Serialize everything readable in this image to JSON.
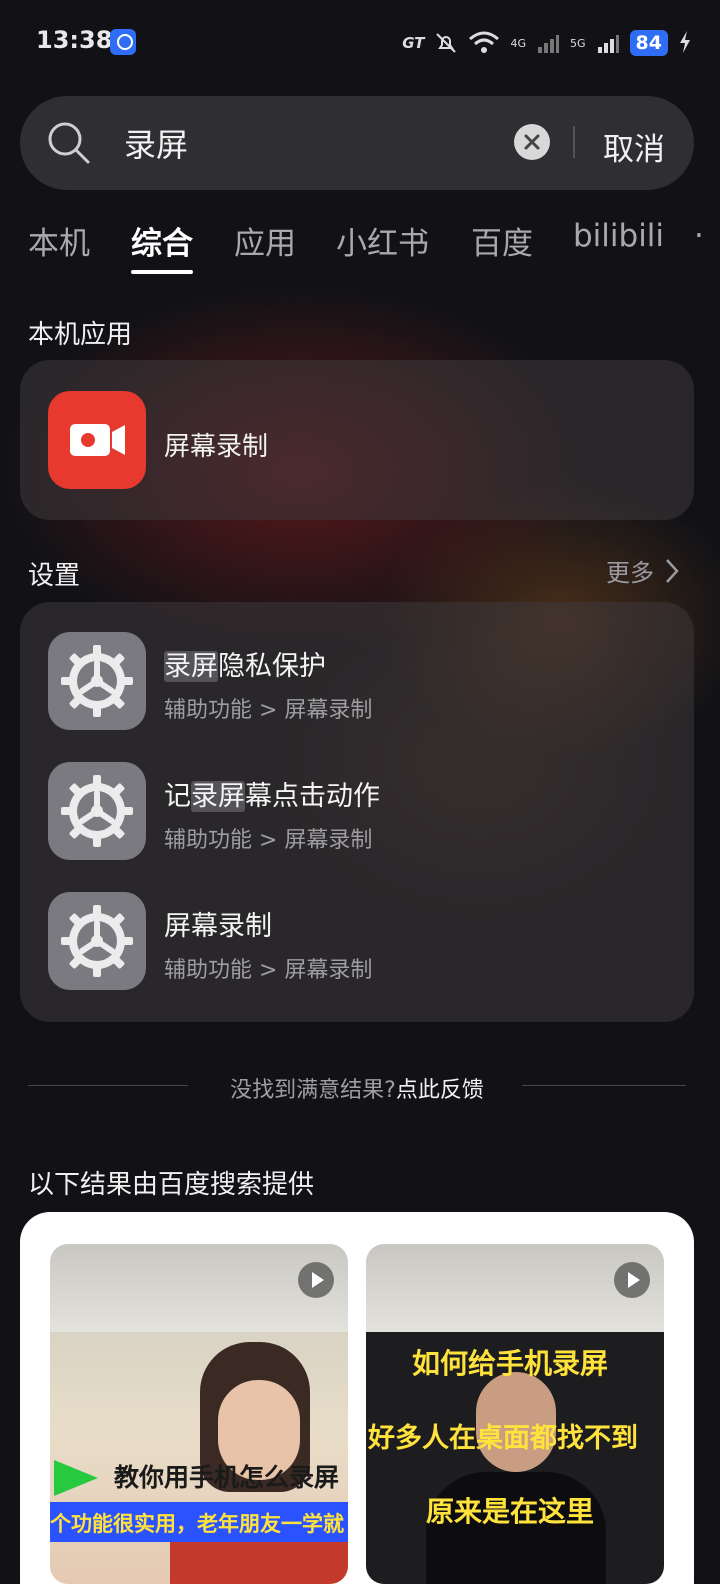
{
  "status": {
    "time": "13:38",
    "carrier_logo": "GT",
    "signal_4g": "4G",
    "signal_5g": "5G",
    "battery": "84"
  },
  "search": {
    "query": "录屏",
    "cancel_label": "取消"
  },
  "tabs": [
    "本机",
    "综合",
    "应用",
    "小红书",
    "百度",
    "bilibili"
  ],
  "active_tab": "综合",
  "local_apps": {
    "title": "本机应用",
    "app_name": "屏幕录制"
  },
  "settings": {
    "title": "设置",
    "more_label": "更多",
    "items": [
      {
        "title_hl": "录屏",
        "title_rest": "隐私保护",
        "title_pre": "",
        "path": "辅助功能 > 屏幕录制"
      },
      {
        "title_pre": "记",
        "title_hl": "录屏",
        "title_rest": "幕点击动作",
        "path": "辅助功能 > 屏幕录制"
      },
      {
        "title_pre": "",
        "title_hl": "",
        "title_rest": "屏幕录制",
        "path": "辅助功能 > 屏幕录制"
      }
    ]
  },
  "feedback": {
    "question": "没找到满意结果?",
    "link": "点此反馈"
  },
  "baidu": {
    "title": "以下结果由百度搜索提供",
    "videos": [
      {
        "caption1": "教你用手机怎么录屏",
        "caption2": "个功能很实用，老年朋友一学就"
      },
      {
        "caption1": "如何给手机录屏",
        "caption2": "好多人在桌面都找不到",
        "caption3": "原来是在这里"
      }
    ]
  },
  "colors": {
    "accent_blue": "#2f6df6",
    "app_red": "#e8392f",
    "caption_yellow": "#ffe23b"
  }
}
